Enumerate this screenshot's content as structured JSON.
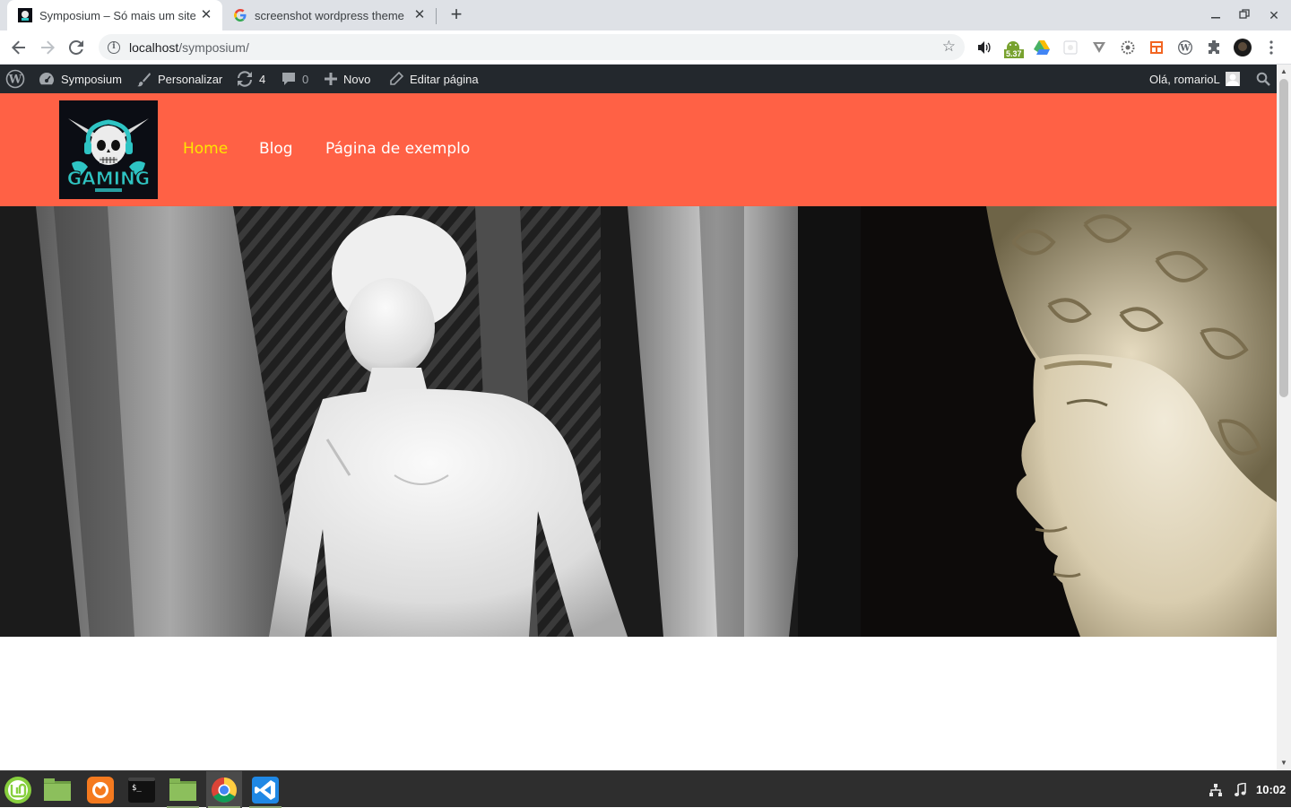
{
  "browser": {
    "tabs": [
      {
        "title": "Symposium – Só mais um site W",
        "active": true
      },
      {
        "title": "screenshot wordpress theme",
        "active": false
      }
    ],
    "url": {
      "host": "localhost",
      "path": "/symposium/"
    },
    "extensions": [
      "volume-icon",
      "android-badge-icon",
      "google-drive-icon",
      "extension-blank-icon",
      "vimeo-like-icon",
      "gear-icon",
      "layout-icon",
      "wordpress-icon",
      "puzzle-icon",
      "profile-avatar-icon",
      "menu-dots-icon"
    ],
    "android_badge": "5.37"
  },
  "adminbar": {
    "site_name": "Symposium",
    "customize": "Personalizar",
    "updates_count": "4",
    "comments_count": "0",
    "new_label": "Novo",
    "edit_page": "Editar página",
    "greeting": "Olá, romarioL"
  },
  "site": {
    "colors": {
      "header_bg": "#ff6145",
      "nav_current": "#ffe500",
      "nav_link": "#ffffff"
    },
    "logo_text": "GAMING",
    "nav": [
      {
        "label": "Home",
        "current": true
      },
      {
        "label": "Blog",
        "current": false
      },
      {
        "label": "Página de exemplo",
        "current": false
      }
    ]
  },
  "taskbar": {
    "apps": [
      "linux-mint-menu-icon",
      "files-icon",
      "firefox-icon",
      "terminal-icon",
      "folder-icon",
      "chrome-icon",
      "vscode-icon"
    ],
    "clock": "10:02"
  }
}
